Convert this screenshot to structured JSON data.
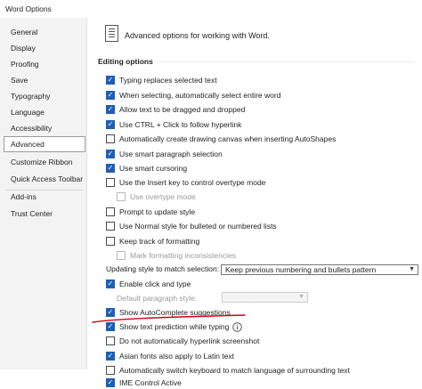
{
  "window": {
    "title": "Word Options"
  },
  "sidebar": {
    "items": [
      {
        "label": "General"
      },
      {
        "label": "Display"
      },
      {
        "label": "Proofing"
      },
      {
        "label": "Save"
      },
      {
        "label": "Typography"
      },
      {
        "label": "Language"
      },
      {
        "label": "Accessibility"
      },
      {
        "label": "Advanced"
      },
      {
        "label": "Customize Ribbon"
      },
      {
        "label": "Quick Access Toolbar"
      },
      {
        "label": "Add-ins"
      },
      {
        "label": "Trust Center"
      }
    ],
    "selected": "Advanced"
  },
  "header": {
    "icon": "document-options-icon",
    "text": "Advanced options for working with Word."
  },
  "section": {
    "title": "Editing options"
  },
  "options": {
    "typing_replaces": {
      "label": "Typing replaces selected text",
      "checked": true
    },
    "select_entire_word": {
      "label": "When selecting, automatically select entire word",
      "checked": true
    },
    "drag_drop": {
      "label": "Allow text to be dragged and dropped",
      "checked": true
    },
    "ctrl_click": {
      "label": "Use CTRL + Click to follow hyperlink",
      "checked": true
    },
    "drawing_canvas": {
      "label": "Automatically create drawing canvas when inserting AutoShapes",
      "checked": false
    },
    "smart_paragraph": {
      "label": "Use smart paragraph selection",
      "checked": true
    },
    "smart_cursoring": {
      "label": "Use smart cursoring",
      "checked": true
    },
    "insert_key": {
      "label": "Use the Insert key to control overtype mode",
      "checked": false
    },
    "overtype_mode": {
      "label": "Use overtype mode",
      "checked": false,
      "disabled": true
    },
    "prompt_style": {
      "label": "Prompt to update style",
      "checked": false
    },
    "normal_style": {
      "label": "Use Normal style for bulleted or numbered lists",
      "checked": false
    },
    "track_formatting": {
      "label": "Keep track of formatting",
      "checked": false
    },
    "mark_inconsistencies": {
      "label": "Mark formatting inconsistencies",
      "checked": false,
      "disabled": true
    },
    "enable_click_type": {
      "label": "Enable click and type",
      "checked": true
    },
    "show_autocomplete": {
      "label": "Show AutoComplete suggestions",
      "checked": true
    },
    "text_prediction": {
      "label": "Show text prediction while typing",
      "checked": true
    },
    "auto_hyperlink_screenshot": {
      "label": "Do not automatically hyperlink screenshot",
      "checked": false
    },
    "asian_fonts": {
      "label": "Asian fonts also apply to Latin text",
      "checked": true
    },
    "switch_keyboard": {
      "label": "Automatically switch keyboard to match language of surrounding text",
      "checked": false
    },
    "ime_control": {
      "label": "IME Control Active",
      "checked": true
    }
  },
  "updating_style": {
    "label": "Updating style to match selection:",
    "value": "Keep previous numbering and bullets pattern"
  },
  "default_paragraph_style": {
    "label": "Default paragraph style:",
    "value": ""
  },
  "colors": {
    "accent": "#1e5fb4",
    "annotation": "#d4001a"
  },
  "icons": {
    "info": "info-icon",
    "dropdown": "chevron-down-icon"
  }
}
